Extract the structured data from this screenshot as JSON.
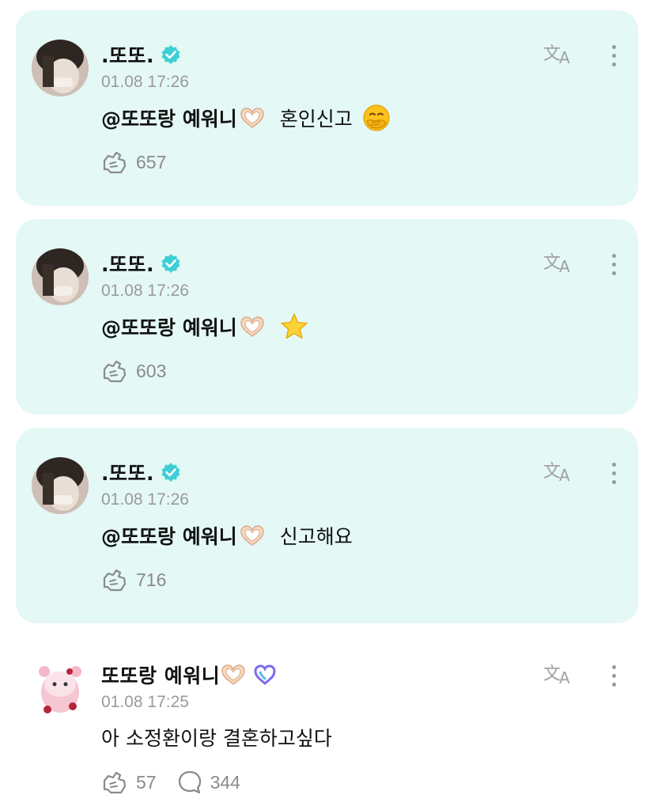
{
  "comments": [
    {
      "author": ".또또.",
      "verified": true,
      "timestamp": "01.08 17:26",
      "mention": "@또또랑 예워니",
      "text": "혼인신고",
      "emoji": "face-with-hand-over-mouth",
      "likes": "657",
      "highlighted": true
    },
    {
      "author": ".또또.",
      "verified": true,
      "timestamp": "01.08 17:26",
      "mention": "@또또랑 예워니",
      "text": "",
      "emoji": "star",
      "likes": "603",
      "highlighted": true
    },
    {
      "author": ".또또.",
      "verified": true,
      "timestamp": "01.08 17:26",
      "mention": "@또또랑 예워니",
      "text": "신고해요",
      "emoji": "",
      "likes": "716",
      "highlighted": true
    },
    {
      "author": "또또랑 예워니",
      "verified": false,
      "membership_badge": "heart-badge",
      "timestamp": "01.08 17:25",
      "mention": "",
      "text": "아 소정환이랑 결혼하고싶다",
      "likes": "57",
      "replies": "344",
      "highlighted": false
    }
  ],
  "icons": {
    "translate": "translate-icon",
    "more": "more-vertical-icon",
    "like": "like-hand-icon",
    "reply": "reply-bubble-icon",
    "verified": "verified-check-icon"
  },
  "colors": {
    "highlight_bg": "#e4f8f5",
    "verified": "#3ecfd6",
    "muted": "#9a9a9a",
    "badge": "#7b6cf0"
  }
}
